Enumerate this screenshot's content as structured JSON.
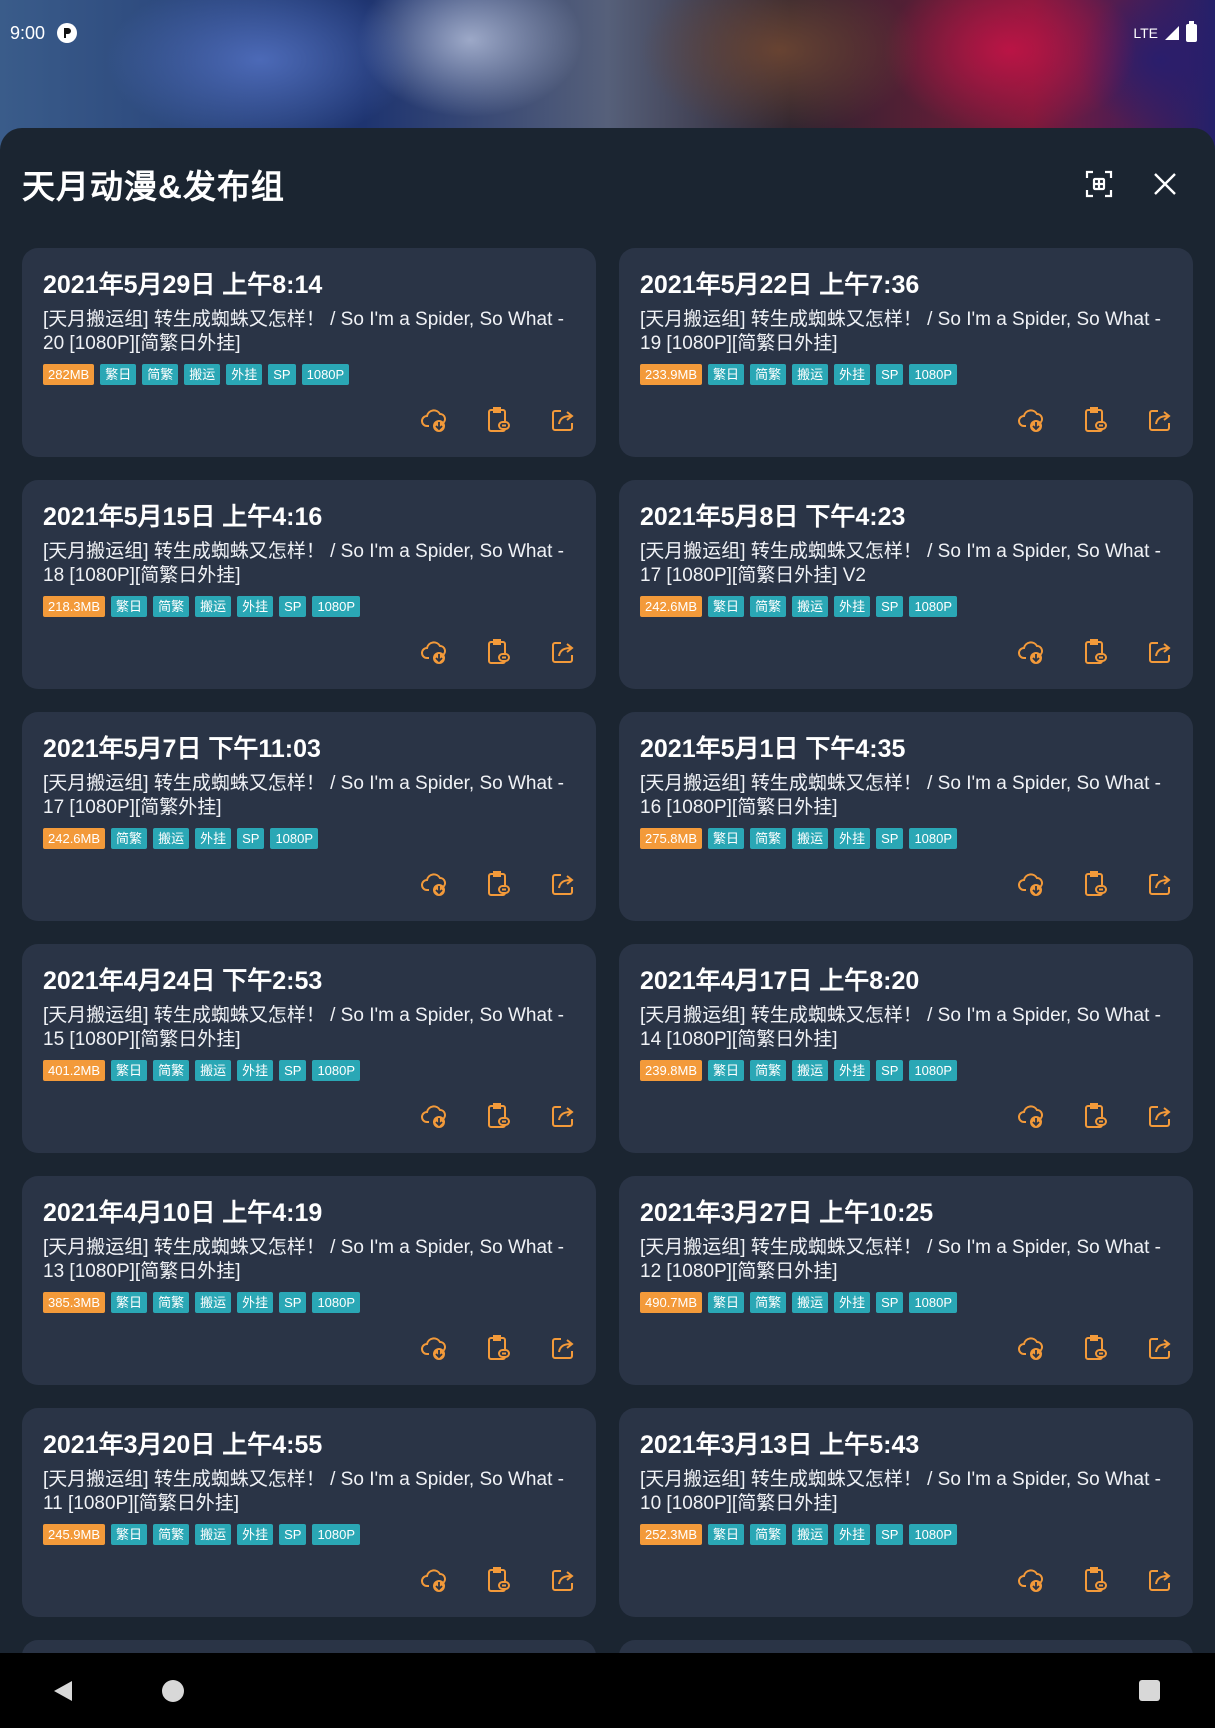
{
  "status_bar": {
    "time": "9:00",
    "network": "LTE"
  },
  "sheet": {
    "title": "天月动漫&发布组"
  },
  "cards": [
    {
      "date": "2021年5月29日 上午8:14",
      "title": "[天月搬运组] 转生成蜘蛛又怎样！ / So I'm a Spider, So What - 20 [1080P][简繁日外挂]",
      "size": "282MB",
      "tags": [
        "繁日",
        "简繁",
        "搬运",
        "外挂",
        "SP",
        "1080P"
      ]
    },
    {
      "date": "2021年5月22日 上午7:36",
      "title": "[天月搬运组] 转生成蜘蛛又怎样！ / So I'm a Spider, So What - 19 [1080P][简繁日外挂]",
      "size": "233.9MB",
      "tags": [
        "繁日",
        "简繁",
        "搬运",
        "外挂",
        "SP",
        "1080P"
      ]
    },
    {
      "date": "2021年5月15日 上午4:16",
      "title": "[天月搬运组] 转生成蜘蛛又怎样！ / So I'm a Spider, So What - 18 [1080P][简繁日外挂]",
      "size": "218.3MB",
      "tags": [
        "繁日",
        "简繁",
        "搬运",
        "外挂",
        "SP",
        "1080P"
      ]
    },
    {
      "date": "2021年5月8日 下午4:23",
      "title": "[天月搬运组] 转生成蜘蛛又怎样！ / So I'm a Spider, So What - 17 [1080P][简繁日外挂] V2",
      "size": "242.6MB",
      "tags": [
        "繁日",
        "简繁",
        "搬运",
        "外挂",
        "SP",
        "1080P"
      ]
    },
    {
      "date": "2021年5月7日 下午11:03",
      "title": "[天月搬运组] 转生成蜘蛛又怎样！ / So I'm a Spider, So What - 17 [1080P][简繁外挂]",
      "size": "242.6MB",
      "tags": [
        "简繁",
        "搬运",
        "外挂",
        "SP",
        "1080P"
      ]
    },
    {
      "date": "2021年5月1日 下午4:35",
      "title": "[天月搬运组] 转生成蜘蛛又怎样！ / So I'm a Spider, So What - 16 [1080P][简繁日外挂]",
      "size": "275.8MB",
      "tags": [
        "繁日",
        "简繁",
        "搬运",
        "外挂",
        "SP",
        "1080P"
      ]
    },
    {
      "date": "2021年4月24日 下午2:53",
      "title": "[天月搬运组] 转生成蜘蛛又怎样！ / So I'm a Spider, So What - 15 [1080P][简繁日外挂]",
      "size": "401.2MB",
      "tags": [
        "繁日",
        "简繁",
        "搬运",
        "外挂",
        "SP",
        "1080P"
      ]
    },
    {
      "date": "2021年4月17日 上午8:20",
      "title": "[天月搬运组] 转生成蜘蛛又怎样！ / So I'm a Spider, So What - 14 [1080P][简繁日外挂]",
      "size": "239.8MB",
      "tags": [
        "繁日",
        "简繁",
        "搬运",
        "外挂",
        "SP",
        "1080P"
      ]
    },
    {
      "date": "2021年4月10日 上午4:19",
      "title": "[天月搬运组] 转生成蜘蛛又怎样！ / So I'm a Spider, So What - 13 [1080P][简繁日外挂]",
      "size": "385.3MB",
      "tags": [
        "繁日",
        "简繁",
        "搬运",
        "外挂",
        "SP",
        "1080P"
      ]
    },
    {
      "date": "2021年3月27日 上午10:25",
      "title": "[天月搬运组] 转生成蜘蛛又怎样！ / So I'm a Spider, So What - 12 [1080P][简繁日外挂]",
      "size": "490.7MB",
      "tags": [
        "繁日",
        "简繁",
        "搬运",
        "外挂",
        "SP",
        "1080P"
      ]
    },
    {
      "date": "2021年3月20日 上午4:55",
      "title": "[天月搬运组] 转生成蜘蛛又怎样！ / So I'm a Spider, So What - 11 [1080P][简繁日外挂]",
      "size": "245.9MB",
      "tags": [
        "繁日",
        "简繁",
        "搬运",
        "外挂",
        "SP",
        "1080P"
      ]
    },
    {
      "date": "2021年3月13日 上午5:43",
      "title": "[天月搬运组] 转生成蜘蛛又怎样！ / So I'm a Spider, So What - 10 [1080P][简繁日外挂]",
      "size": "252.3MB",
      "tags": [
        "繁日",
        "简繁",
        "搬运",
        "外挂",
        "SP",
        "1080P"
      ]
    }
  ],
  "colors": {
    "accent": "#f39a3a",
    "tag": "#2aa7b5",
    "card": "#2a3446",
    "sheet": "#1b2531"
  },
  "icons": {
    "download": "cloud-download-icon",
    "copy": "clipboard-link-icon",
    "share": "share-icon",
    "scan": "scan-icon",
    "close": "close-icon"
  }
}
